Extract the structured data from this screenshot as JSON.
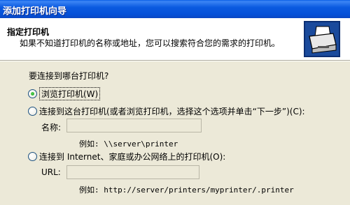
{
  "window": {
    "title": "添加打印机向导"
  },
  "header": {
    "title": "指定打印机",
    "subtitle": "如果不知道打印机的名称或地址，您可以搜索符合您的需求的打印机。",
    "icon": "printer-icon"
  },
  "question": "要连接到哪台打印机?",
  "options": {
    "browse": {
      "label": "浏览打印机(W)",
      "checked": true
    },
    "connect": {
      "label": "连接到这台打印机(或者浏览打印机，选择这个选项并单击“下一步”)(C):",
      "checked": false
    },
    "internet": {
      "label": "连接到 Internet、家庭或办公网络上的打印机(O):",
      "checked": false
    }
  },
  "name_field": {
    "label": "名称:",
    "value": "",
    "example": "例如: \\\\server\\printer"
  },
  "url_field": {
    "label": "URL:",
    "value": "",
    "example": "例如: http://server/printers/myprinter/.printer"
  },
  "colors": {
    "titlebar": "#0a5fe6",
    "dialog_bg": "#ece9d8",
    "header_bg": "#ffffff"
  }
}
